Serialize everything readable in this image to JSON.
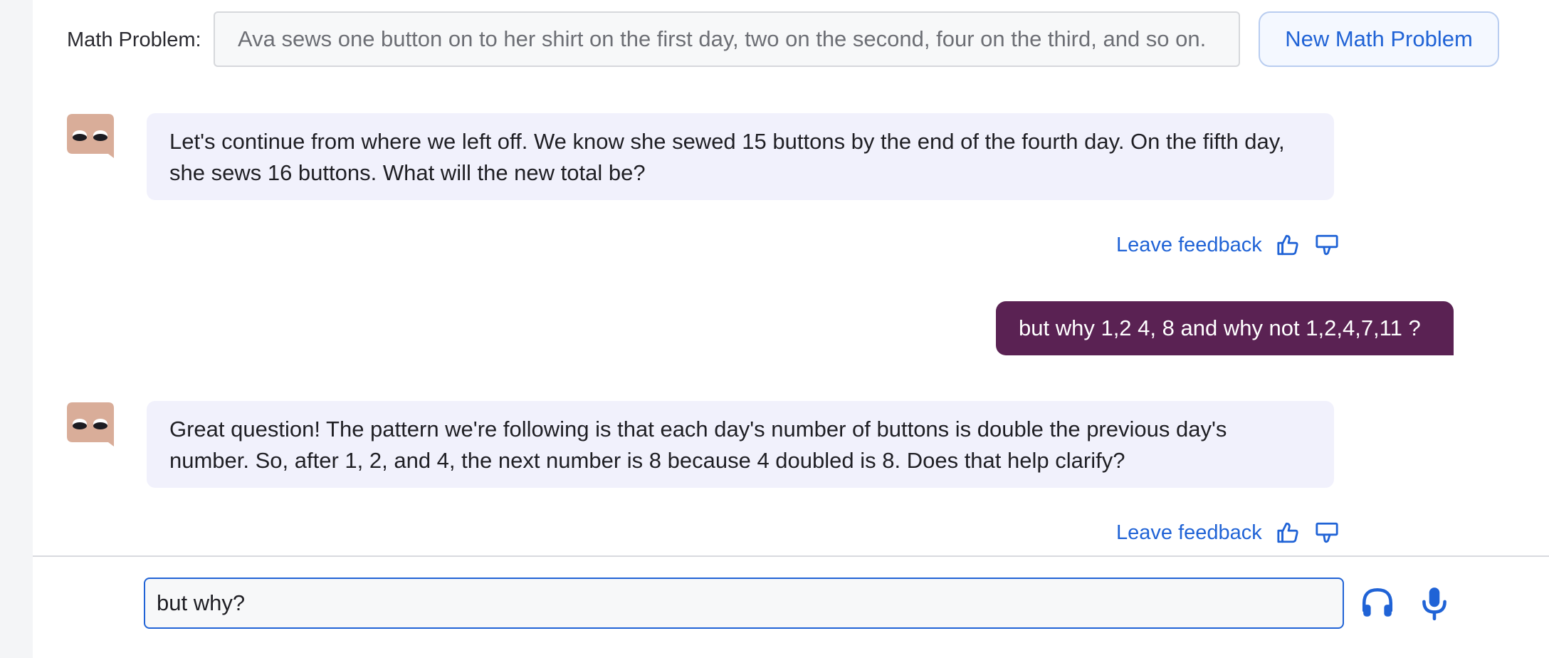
{
  "header": {
    "problem_label": "Math Problem:",
    "problem_text": "Ava sews one button on to her shirt on the first day, two on the second, four on the third, and so on.",
    "new_problem_button": "New Math Problem"
  },
  "messages": [
    {
      "role": "bot",
      "text": "Let's continue from where we left off. We know she sewed 15 buttons by the end of the fourth day. On the fifth day, she sews 16 buttons. What will the new total be?",
      "feedback_label": "Leave feedback"
    },
    {
      "role": "user",
      "text": "but why 1,2 4, 8 and why not 1,2,4,7,11 ?"
    },
    {
      "role": "bot",
      "text": "Great question! The pattern we're following is that each day's number of buttons is double the previous day's number. So, after 1, 2, and 4, the next number is 8 because 4 doubled is 8. Does that help clarify?",
      "feedback_label": "Leave feedback"
    }
  ],
  "composer": {
    "value": "but why?",
    "headphones_icon": "headphones-icon",
    "microphone_icon": "microphone-icon"
  },
  "icons": {
    "avatar": "robot-face-icon",
    "thumbs_up": "thumbs-up-icon",
    "thumbs_down": "thumbs-down-icon"
  },
  "colors": {
    "accent": "#2063d6",
    "user_bubble": "#5a2253",
    "bot_bubble": "#f1f1fc",
    "avatar": "#d9ad99"
  }
}
